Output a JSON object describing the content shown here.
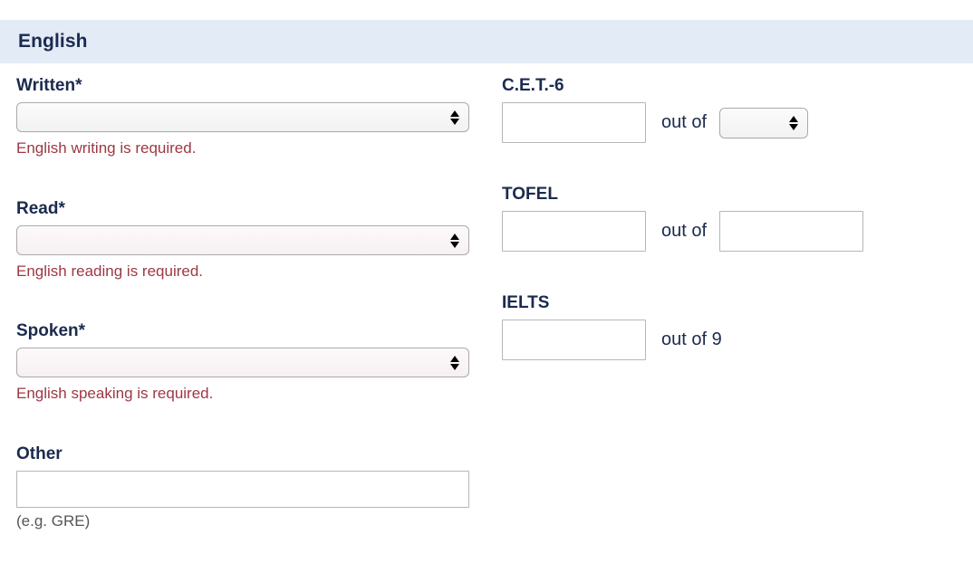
{
  "section": {
    "title": "English",
    "header_bg": "#e2ebf6",
    "heading_color": "#1b2a4e",
    "error_color": "#9c3843"
  },
  "left_column": {
    "written": {
      "label": "Written*",
      "select_value": "",
      "error": "English writing is required."
    },
    "read": {
      "label": "Read*",
      "select_value": "",
      "error": "English reading is required."
    },
    "spoken": {
      "label": "Spoken*",
      "select_value": "",
      "error": "English speaking is required."
    },
    "other": {
      "label": "Other",
      "input_value": "",
      "hint": "(e.g. GRE)"
    }
  },
  "right_column": {
    "cet6": {
      "label": "C.E.T.-6",
      "score_value": "",
      "out_of_label": "out of",
      "max_select_value": ""
    },
    "tofel": {
      "label": "TOFEL",
      "score_value": "",
      "out_of_label": "out of",
      "max_value": ""
    },
    "ielts": {
      "label": "IELTS",
      "score_value": "",
      "out_of_label": "out of 9"
    }
  }
}
